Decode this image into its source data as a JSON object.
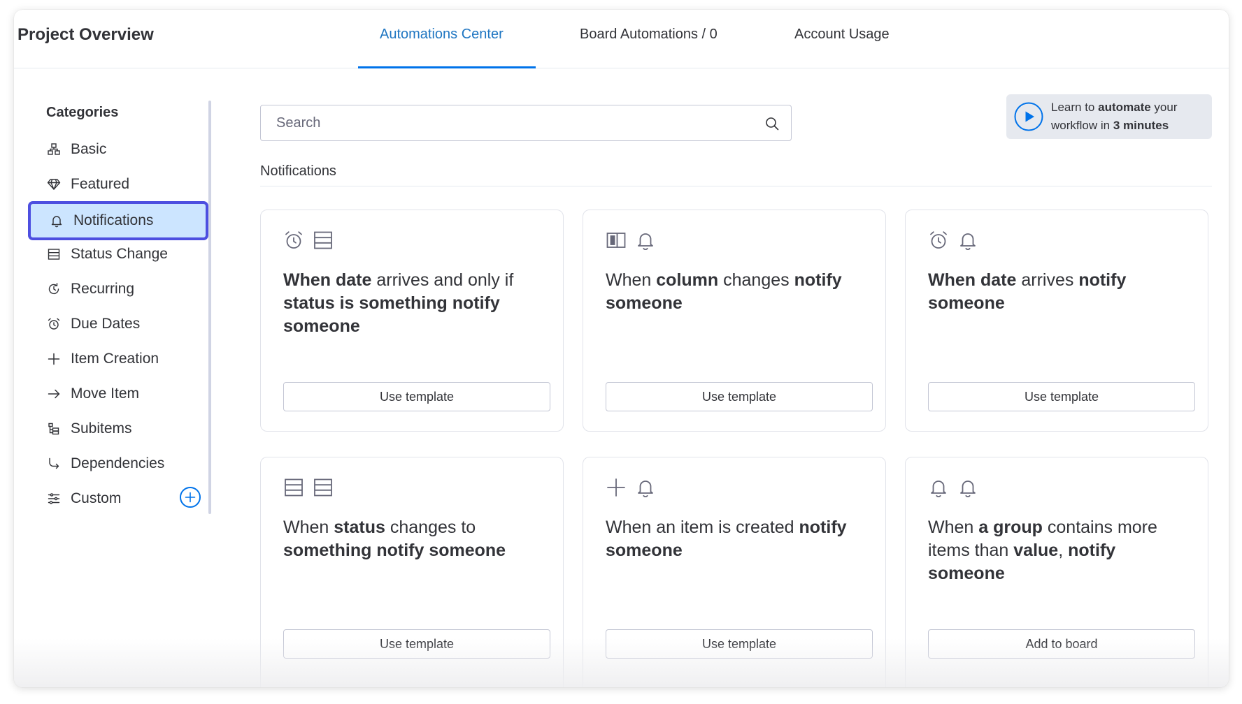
{
  "header": {
    "project_title": "Project Overview",
    "tabs": [
      {
        "label": "Automations Center",
        "active": true
      },
      {
        "label": "Board Automations / 0",
        "active": false
      },
      {
        "label": "Account Usage",
        "active": false
      }
    ]
  },
  "sidebar": {
    "title": "Categories",
    "items": [
      {
        "label": "Basic",
        "icon": "basic-icon"
      },
      {
        "label": "Featured",
        "icon": "diamond-icon"
      },
      {
        "label": "Notifications",
        "icon": "bell-icon",
        "active": true
      },
      {
        "label": "Status Change",
        "icon": "table-icon"
      },
      {
        "label": "Recurring",
        "icon": "recurring-icon"
      },
      {
        "label": "Due Dates",
        "icon": "alarm-icon"
      },
      {
        "label": "Item Creation",
        "icon": "plus-icon"
      },
      {
        "label": "Move Item",
        "icon": "arrow-right-icon"
      },
      {
        "label": "Subitems",
        "icon": "subitems-icon"
      },
      {
        "label": "Dependencies",
        "icon": "dependency-icon"
      },
      {
        "label": "Custom",
        "icon": "sliders-icon"
      }
    ]
  },
  "search": {
    "placeholder": "Search"
  },
  "learn": {
    "t1": "Learn to ",
    "t2": "automate",
    "t3": " your",
    "t4": "workflow in ",
    "t5": "3 minutes"
  },
  "section": {
    "title": "Notifications"
  },
  "cards": [
    {
      "icons": [
        "alarm-icon",
        "table-icon"
      ],
      "parts": [
        [
          "When date",
          true
        ],
        [
          " arrives and only if ",
          false
        ],
        [
          "status is something notify someone",
          true
        ]
      ],
      "button": "Use template"
    },
    {
      "icons": [
        "column-icon",
        "bell-icon"
      ],
      "parts": [
        [
          "When ",
          false
        ],
        [
          "column",
          true
        ],
        [
          " changes ",
          false
        ],
        [
          "notify someone",
          true
        ]
      ],
      "button": "Use template"
    },
    {
      "icons": [
        "alarm-icon",
        "bell-icon"
      ],
      "parts": [
        [
          "When date",
          true
        ],
        [
          " arrives ",
          false
        ],
        [
          "notify someone",
          true
        ]
      ],
      "button": "Use template"
    },
    {
      "icons": [
        "table-icon",
        "table-icon"
      ],
      "parts": [
        [
          "When ",
          false
        ],
        [
          "status",
          true
        ],
        [
          " changes to ",
          false
        ],
        [
          "something notify someone",
          true
        ]
      ],
      "button": "Use template"
    },
    {
      "icons": [
        "plus-icon",
        "bell-icon"
      ],
      "parts": [
        [
          "When an item is created ",
          false
        ],
        [
          "notify someone",
          true
        ]
      ],
      "button": "Use template"
    },
    {
      "icons": [
        "bell-icon",
        "bell-icon"
      ],
      "parts": [
        [
          "When ",
          false
        ],
        [
          "a group",
          true
        ],
        [
          " contains more items than ",
          false
        ],
        [
          "value",
          true
        ],
        [
          ", ",
          false
        ],
        [
          "notify someone",
          true
        ]
      ],
      "button": "Add to board"
    }
  ],
  "colors": {
    "accent": "#0073ea",
    "active_bg": "#cce5ff",
    "active_border": "#4d4fe0",
    "text": "#323338"
  }
}
